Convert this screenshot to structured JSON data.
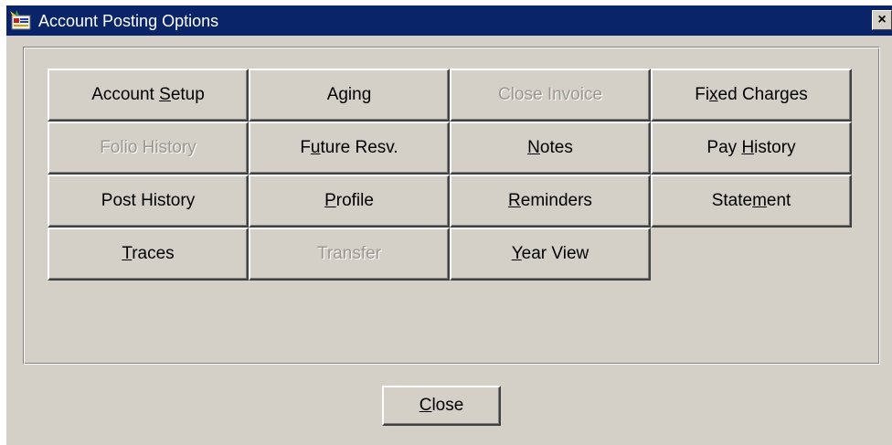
{
  "window": {
    "title": "Account Posting Options",
    "close_glyph": "×"
  },
  "buttons": [
    {
      "pre": "Account ",
      "u": "S",
      "post": "etup",
      "enabled": true
    },
    {
      "pre": "Aging",
      "u": "",
      "post": "",
      "enabled": true
    },
    {
      "pre": "Close Invoice",
      "u": "",
      "post": "",
      "enabled": false
    },
    {
      "pre": "Fi",
      "u": "x",
      "post": "ed Charges",
      "enabled": true
    },
    {
      "pre": "Folio History",
      "u": "",
      "post": "",
      "enabled": false
    },
    {
      "pre": "F",
      "u": "u",
      "post": "ture Resv.",
      "enabled": true
    },
    {
      "pre": "",
      "u": "N",
      "post": "otes",
      "enabled": true
    },
    {
      "pre": "Pay ",
      "u": "H",
      "post": "istory",
      "enabled": true
    },
    {
      "pre": "Post History",
      "u": "",
      "post": "",
      "enabled": true
    },
    {
      "pre": "",
      "u": "P",
      "post": "rofile",
      "enabled": true
    },
    {
      "pre": "",
      "u": "R",
      "post": "eminders",
      "enabled": true
    },
    {
      "pre": "State",
      "u": "m",
      "post": "ent",
      "enabled": true
    },
    {
      "pre": "",
      "u": "T",
      "post": "races",
      "enabled": true
    },
    {
      "pre": "Transfer",
      "u": "",
      "post": "",
      "enabled": false
    },
    {
      "pre": "",
      "u": "Y",
      "post": "ear View",
      "enabled": true
    }
  ],
  "footer": {
    "close": {
      "pre": "",
      "u": "C",
      "post": "lose"
    }
  },
  "colors": {
    "titlebar": "#0a246a",
    "face": "#d4d0c8",
    "disabled_text": "#9a978f"
  },
  "icons": {
    "app": "opera-app-icon",
    "close": "close-icon"
  }
}
